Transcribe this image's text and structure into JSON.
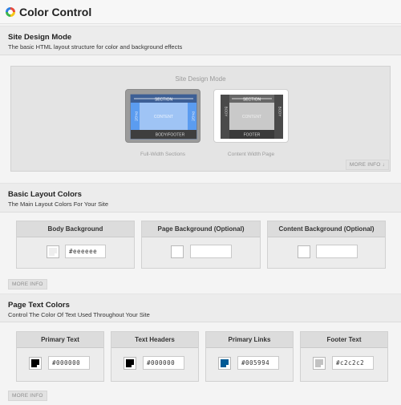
{
  "header": {
    "title": "Color Control",
    "logo_icon": "color-wheel-icon"
  },
  "site_design": {
    "title": "Site Design Mode",
    "description": "The basic HTML layout structure for color and background effects",
    "panel_title": "Site Design Mode",
    "options": [
      {
        "caption": "Full-Width Sections",
        "selected": true,
        "labels": {
          "top": "SECTION",
          "center": "CONTENT",
          "left": "PAGE",
          "right": "PAGE",
          "bottom": "BODY/FOOTER"
        }
      },
      {
        "caption": "Content Width Page",
        "selected": false,
        "labels": {
          "top": "SECTION",
          "center": "CONTENT",
          "left": "BODY",
          "right": "BODY",
          "bottom": "FOOTER"
        }
      }
    ],
    "more_info": "MORE INFO ↓"
  },
  "layout_colors": {
    "title": "Basic Layout Colors",
    "description": "The Main Layout Colors For Your Site",
    "boxes": [
      {
        "label": "Body Background",
        "value": "#eeeeee",
        "swatch": "#eeeeee"
      },
      {
        "label": "Page Background (Optional)",
        "value": "",
        "swatch": "#ffffff"
      },
      {
        "label": "Content Background (Optional)",
        "value": "",
        "swatch": "#ffffff"
      }
    ],
    "more_info": "MORE INFO"
  },
  "text_colors": {
    "title": "Page Text Colors",
    "description": "Control The Color Of Text Used Throughout Your Site",
    "boxes": [
      {
        "label": "Primary Text",
        "value": "#000000",
        "swatch": "#000000"
      },
      {
        "label": "Text Headers",
        "value": "#000000",
        "swatch": "#000000"
      },
      {
        "label": "Primary Links",
        "value": "#005994",
        "swatch": "#005994"
      },
      {
        "label": "Footer Text",
        "value": "#c2c2c2",
        "swatch": "#c2c2c2"
      }
    ],
    "more_info": "MORE INFO"
  }
}
